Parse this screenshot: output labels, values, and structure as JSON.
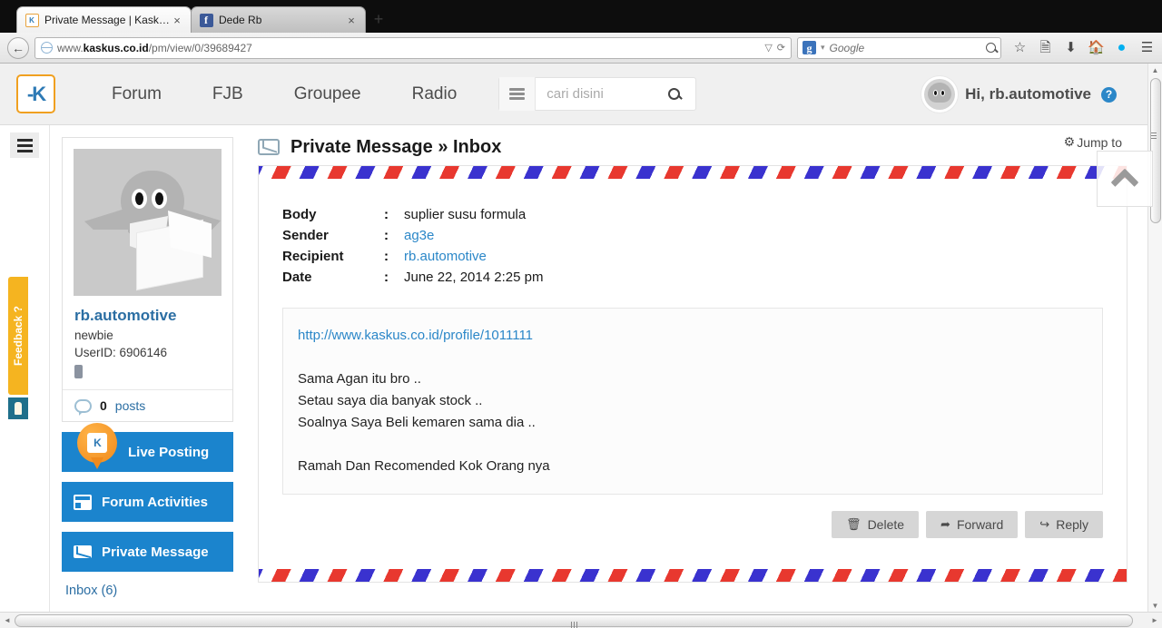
{
  "browser": {
    "tabs": [
      {
        "title": "Private Message | Kaskus - ...",
        "favicon": "kaskus-icon",
        "close": "×",
        "active": true
      },
      {
        "title": "Dede Rb",
        "favicon": "facebook-icon",
        "close": "×",
        "active": false
      }
    ],
    "new_tab_label": "+",
    "back_icon": "←",
    "url_prefix": "www.",
    "url_domain": "kaskus.co.id",
    "url_path": "/pm/view/0/39689427",
    "url_full": "www.kaskus.co.id/pm/view/0/39689427",
    "url_dropdown_icon": "▽",
    "reload_icon": "⟳",
    "search_provider": "Google",
    "search_provider_icon": "google-g-icon",
    "toolbar_icons": [
      "bookmark-star-icon",
      "reading-list-icon",
      "downloads-icon",
      "home-icon",
      "skype-icon",
      "menu-icon"
    ]
  },
  "site_header": {
    "logo_text": "-K",
    "nav": [
      {
        "label": "Forum"
      },
      {
        "label": "FJB"
      },
      {
        "label": "Groupee"
      },
      {
        "label": "Radio"
      }
    ],
    "search_placeholder": "cari disini",
    "search_value": "",
    "menu_icon": "hamburger-icon",
    "search_icon": "search-icon",
    "greeting": "Hi, rb.automotive",
    "help_icon": "?"
  },
  "rail": {
    "menu_icon": "hamburger-icon",
    "feedback_label": "Feedback ?",
    "feedback_icon": "lightbulb-icon"
  },
  "sidebar": {
    "avatar_alt": "ghost-envelope-avatar",
    "username": "rb.automotive",
    "rank": "newbie",
    "userid": "UserID: 6906146",
    "badge": "mobile-badge",
    "posts_count": "0",
    "posts_label": "posts",
    "buttons": [
      {
        "label": "Live Posting",
        "icon": "kaskus-pin-icon"
      },
      {
        "label": "Forum Activities",
        "icon": "calendar-icon"
      },
      {
        "label": "Private Message",
        "icon": "envelope-icon"
      }
    ],
    "inbox_link": "Inbox (6)"
  },
  "main": {
    "title": "Private Message » Inbox",
    "title_icon": "envelope-icon",
    "jump_to": "Jump to",
    "jump_to_icon": "gear-icon",
    "back_to_top_icon": "chevron-up-icon",
    "meta": [
      {
        "key": "Body",
        "colon": ":",
        "value": "suplier susu formula",
        "link": false
      },
      {
        "key": "Sender",
        "colon": ":",
        "value": "ag3e",
        "link": true
      },
      {
        "key": "Recipient",
        "colon": ":",
        "value": "rb.automotive",
        "link": true
      },
      {
        "key": "Date",
        "colon": ":",
        "value": "June 22, 2014 2:25 pm",
        "link": false
      }
    ],
    "message": {
      "link": "http://www.kaskus.co.id/profile/1011111",
      "lines": [
        "Sama Agan itu bro ..",
        "Setau saya dia banyak stock ..",
        "Soalnya Saya Beli kemaren sama dia .."
      ],
      "closing": "Ramah Dan Recomended Kok Orang nya"
    },
    "actions": [
      {
        "label": "Delete",
        "icon": "trash-icon",
        "glyph": "🗑"
      },
      {
        "label": "Forward",
        "icon": "forward-icon",
        "glyph": "➦"
      },
      {
        "label": "Reply",
        "icon": "reply-icon",
        "glyph": "↪"
      }
    ]
  },
  "colors": {
    "accent_blue": "#1b84cd",
    "link_blue": "#2b87c8",
    "brand_orange": "#f0a020",
    "feedback_yellow": "#f5b420",
    "airmail_red": "#e8382f",
    "airmail_blue": "#3a32cf"
  },
  "scrollbars": {
    "v_up": "▲",
    "v_down": "▼",
    "h_left": "◄",
    "h_right": "►"
  }
}
